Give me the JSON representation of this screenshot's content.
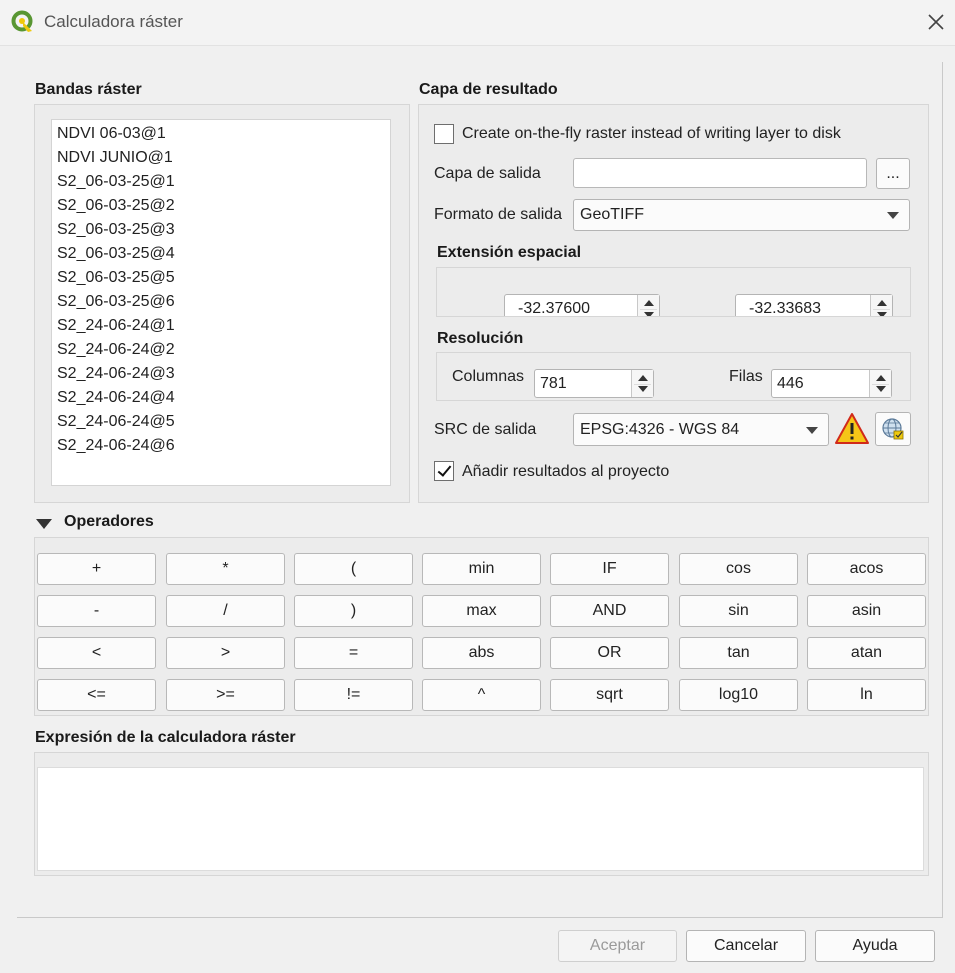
{
  "window": {
    "title": "Calculadora ráster"
  },
  "bands": {
    "title": "Bandas ráster",
    "items": [
      "NDVI 06-03@1",
      "NDVI JUNIO@1",
      "S2_06-03-25@1",
      "S2_06-03-25@2",
      "S2_06-03-25@3",
      "S2_06-03-25@4",
      "S2_06-03-25@5",
      "S2_06-03-25@6",
      "S2_24-06-24@1",
      "S2_24-06-24@2",
      "S2_24-06-24@3",
      "S2_24-06-24@4",
      "S2_24-06-24@5",
      "S2_24-06-24@6"
    ]
  },
  "result": {
    "title": "Capa de resultado",
    "onthefly_label": "Create on-the-fly raster instead of writing layer to disk",
    "onthefly_checked": false,
    "output_layer_label": "Capa de salida",
    "output_layer_value": "",
    "browse_label": "...",
    "format_label": "Formato de salida",
    "format_value": "GeoTIFF",
    "extent_title": "Extensión espacial",
    "extent_left_value": "-32.37600",
    "extent_right_value": "-32.33683",
    "resolution_title": "Resolución",
    "columns_label": "Columnas",
    "columns_value": "781",
    "rows_label": "Filas",
    "rows_value": "446",
    "crs_label": "SRC de salida",
    "crs_value": "EPSG:4326 - WGS 84",
    "add_results_label": "Añadir resultados al proyecto",
    "add_results_checked": true
  },
  "operators": {
    "title": "Operadores",
    "rows": [
      [
        "+",
        "*",
        "(",
        "min",
        "IF",
        "cos",
        "acos"
      ],
      [
        "-",
        "/",
        ")",
        "max",
        "AND",
        "sin",
        "asin"
      ],
      [
        "<",
        ">",
        "=",
        "abs",
        "OR",
        "tan",
        "atan"
      ],
      [
        "<=",
        ">=",
        "!=",
        "^",
        "sqrt",
        "log10",
        "ln"
      ]
    ]
  },
  "expression": {
    "title": "Expresión de la calculadora ráster",
    "value": ""
  },
  "footer": {
    "accept_label": "Aceptar",
    "cancel_label": "Cancelar",
    "help_label": "Ayuda"
  },
  "colors": {
    "qgis_green": "#589632",
    "qgis_yellow": "#eec90d",
    "warning_yellow": "#f5c518",
    "accent_disabled": "#9a9a9a"
  }
}
